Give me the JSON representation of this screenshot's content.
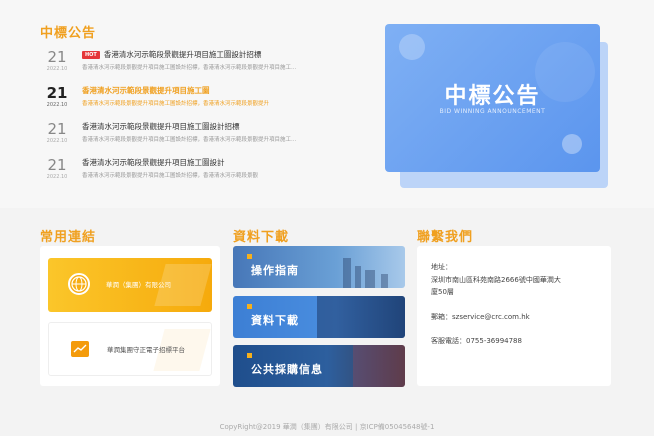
{
  "news": {
    "section_title": "中標公告",
    "items": [
      {
        "day": "21",
        "date": "2022.10",
        "hot": "HOT",
        "title": "香港清水河示範段景觀提升項目施工圖設計招標",
        "desc": "香港清水河示範段景觀提升項目施工圖設計招標，香港清水河示範段景觀提升項目施工..."
      },
      {
        "day": "21",
        "date": "2022.10",
        "hot": "",
        "title": "香港清水河示範段景觀提升項目施工圖",
        "desc": "香港清水河示範段景觀提升項目施工圖設計招標，香港清水河示範段景觀提升"
      },
      {
        "day": "21",
        "date": "2022.10",
        "hot": "",
        "title": "香港清水河示範段景觀提升項目施工圖設計招標",
        "desc": "香港清水河示範段景觀提升項目施工圖設計招標，香港清水河示範段景觀提升項目施工..."
      },
      {
        "day": "21",
        "date": "2022.10",
        "hot": "",
        "title": "香港清水河示範段景觀提升項目施工圖設計",
        "desc": "香港清水河示範段景觀提升項目施工圖設計招標，香港清水河示範段景觀"
      }
    ]
  },
  "banner": {
    "title": "中標公告",
    "subtitle": "BID WINNING ANNOUNCEMENT"
  },
  "links": {
    "section_title": "常用連結",
    "items": [
      {
        "label": "華潤（集團）有限公司",
        "icon": "globe-icon"
      },
      {
        "label": "華潤集團守正電子招標平台",
        "icon": "chart-icon"
      }
    ]
  },
  "downloads": {
    "section_title": "資料下載",
    "items": [
      {
        "label": "操作指南"
      },
      {
        "label": "資料下載"
      },
      {
        "label": "公共採購信息"
      }
    ]
  },
  "contact": {
    "section_title": "聯繫我們",
    "address_label": "地址：",
    "address_line1": "深圳市南山區科苑南路2666號中國華潤大",
    "address_line2": "廈50層",
    "email": "郵箱：szservice@crc.com.hk",
    "phone": "客服電話：0755-36994788"
  },
  "footer": {
    "copyright": "CopyRight@2019 華潤（集團）有限公司 | 京ICP備05045648號-1"
  },
  "colors": {
    "accent": "#f0a020",
    "hot_badge": "#e5373a",
    "banner_blue": "#5b95ee"
  }
}
